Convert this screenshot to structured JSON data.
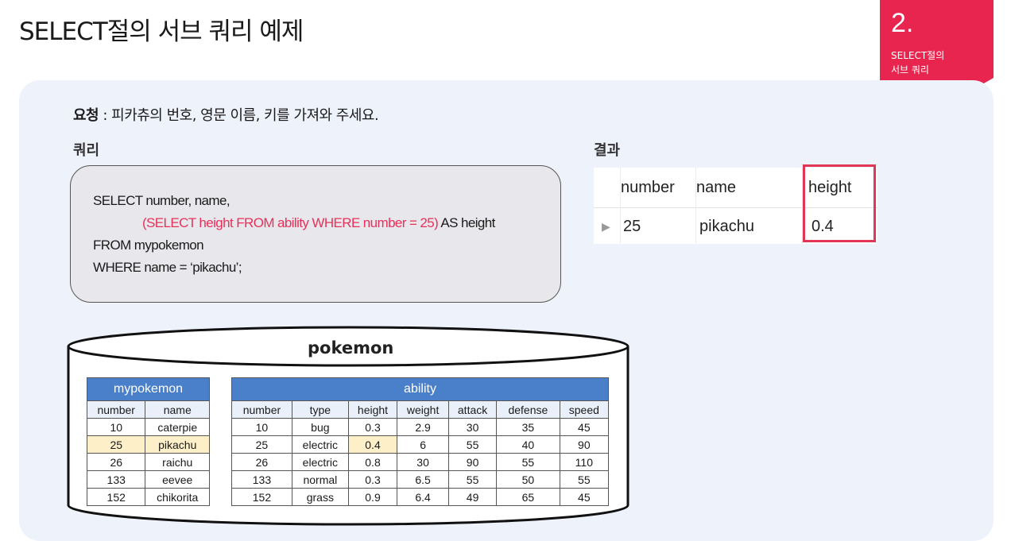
{
  "header": {
    "title": "SELECT절의 서브 쿼리 예제",
    "section_number": "2.",
    "section_title_line1": "SELECT절의",
    "section_title_line2": "서브 쿼리"
  },
  "request": {
    "label": "요청",
    "text": " : 피카츄의 번호, 영문 이름, 키를 가져와 주세요."
  },
  "query": {
    "label": "쿼리",
    "line1": "SELECT number, name,",
    "line2_sub": "(SELECT height FROM ability WHERE number = 25)",
    "line2_rest": " AS height",
    "line3": "FROM mypokemon",
    "line4": "WHERE name = ‘pikachu’;"
  },
  "result": {
    "label": "결과",
    "columns": [
      "number",
      "name",
      "height"
    ],
    "row": [
      "25",
      "pikachu",
      "0.4"
    ]
  },
  "database": {
    "name": "pokemon",
    "mypokemon": {
      "caption": "mypokemon",
      "columns": [
        "number",
        "name"
      ],
      "rows": [
        [
          "10",
          "caterpie"
        ],
        [
          "25",
          "pikachu"
        ],
        [
          "26",
          "raichu"
        ],
        [
          "133",
          "eevee"
        ],
        [
          "152",
          "chikorita"
        ]
      ]
    },
    "ability": {
      "caption": "ability",
      "columns": [
        "number",
        "type",
        "height",
        "weight",
        "attack",
        "defense",
        "speed"
      ],
      "rows": [
        [
          "10",
          "bug",
          "0.3",
          "2.9",
          "30",
          "35",
          "45"
        ],
        [
          "25",
          "electric",
          "0.4",
          "6",
          "55",
          "40",
          "90"
        ],
        [
          "26",
          "electric",
          "0.8",
          "30",
          "90",
          "55",
          "110"
        ],
        [
          "133",
          "normal",
          "0.3",
          "6.5",
          "55",
          "50",
          "55"
        ],
        [
          "152",
          "grass",
          "0.9",
          "6.4",
          "49",
          "65",
          "45"
        ]
      ]
    }
  },
  "colors": {
    "accent": "#e8254f",
    "highlight_row": "#fdf0c8",
    "table_caption": "#4a7fc9",
    "panel": "#eef2fb"
  }
}
